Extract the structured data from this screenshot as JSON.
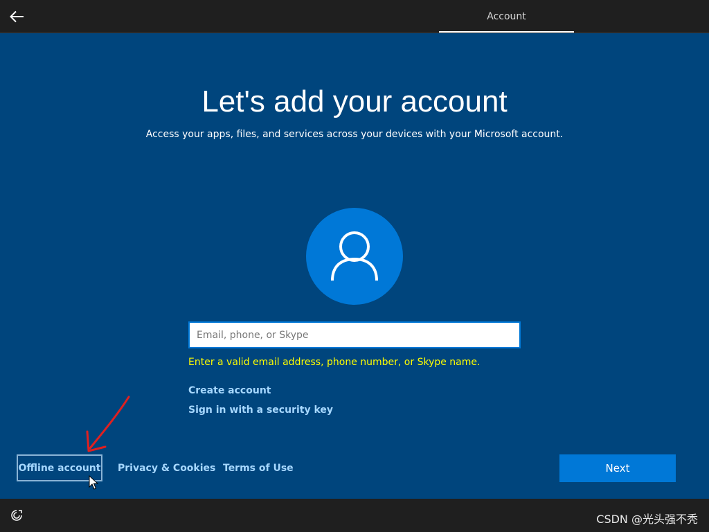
{
  "header": {
    "tab_label": "Account"
  },
  "main": {
    "title": "Let's add your account",
    "subtitle": "Access your apps, files, and services across your devices with your Microsoft account.",
    "email_placeholder": "Email, phone, or Skype",
    "email_value": "",
    "error_message": "Enter a valid email address, phone number, or Skype name.",
    "create_account_label": "Create account",
    "security_key_label": "Sign in with a security key"
  },
  "footer": {
    "offline_account_label": "Offline account",
    "privacy_label": "Privacy & Cookies",
    "terms_label": "Terms of Use",
    "next_label": "Next"
  },
  "bottombar": {
    "watermark": "CSDN @光头强不秃"
  },
  "colors": {
    "background": "#00457d",
    "accent": "#0078d7",
    "bar": "#1f1f1f",
    "link": "#a6d8ff",
    "error": "#ffff00",
    "annotation": "#e02020"
  },
  "icons": {
    "back": "back-arrow-icon",
    "avatar": "user-icon",
    "ease_of_access": "ease-of-access-icon",
    "annotation": "red-arrow-icon",
    "cursor": "mouse-pointer-icon"
  }
}
